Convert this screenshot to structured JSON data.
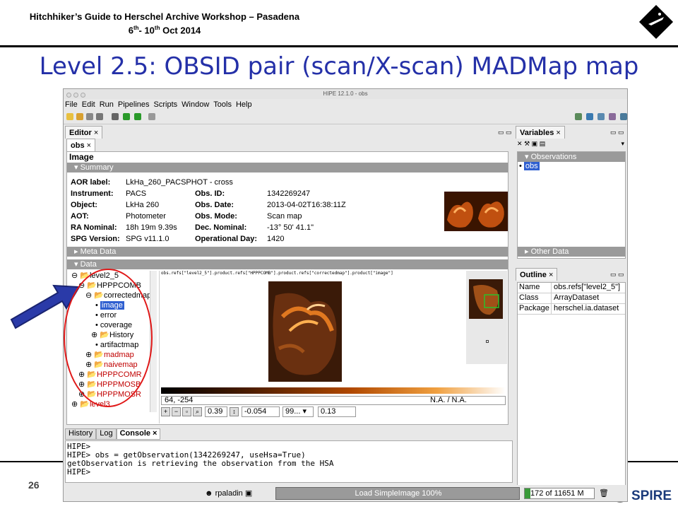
{
  "header": {
    "line1": "Hitchhiker’s Guide to Herschel Archive Workshop – Pasadena",
    "line2_a": "6",
    "line2_sup1": "th",
    "line2_b": "- 10",
    "line2_sup2": "th",
    "line2_c": " Oct 2014"
  },
  "slide_title": "Level 2.5: OBSID pair (scan/X-scan) MADMap map",
  "page_number": "26",
  "window": {
    "title": "HIPE 12.1.0 - obs",
    "menu": [
      "File",
      "Edit",
      "Run",
      "Pipelines",
      "Scripts",
      "Window",
      "Tools",
      "Help"
    ],
    "editor_tab": "Editor",
    "obs_tab": "obs",
    "image_heading": "Image",
    "summary_label": "Summary",
    "summary": {
      "left_keys": [
        "AOR label:",
        "Instrument:",
        "Object:",
        "AOT:",
        "RA Nominal:",
        "SPG Version:"
      ],
      "left_vals": [
        "LkHa_260_PACSPHOT - cross",
        "PACS",
        "LkHa 260",
        "Photometer",
        "18h 19m 9.39s",
        "SPG v11.1.0"
      ],
      "right_keys": [
        "Obs. ID:",
        "Obs. Date:",
        "Obs. Mode:",
        "Dec. Nominal:",
        "Operational Day:"
      ],
      "right_vals": [
        "1342269247",
        "2013-04-02T16:38:11Z",
        "Scan map",
        "-13° 50' 41.1\"",
        "1420"
      ]
    },
    "meta_data_label": "Meta Data",
    "data_label": "Data",
    "tree": [
      "level2_5",
      "HPPPCOMB",
      "correctedmap",
      "image",
      "error",
      "coverage",
      "History",
      "artifactmap",
      "madmap",
      "naivemap",
      "HPPPCOMR",
      "HPPPMOSB",
      "HPPPMOSR",
      "level3"
    ],
    "image_path": "obs.refs[\"level2_5\"].product.refs[\"HPPPCOMB\"].product.refs[\"correctedmap\"].product[\"image\"]",
    "cursor_readout": "64, -254",
    "value_readout": "N.A. / N.A.",
    "zoom": "0.39",
    "cut_low": "-0.054",
    "cut_mode": "99...",
    "cut_high": "0.13",
    "variables_tab": "Variables",
    "observations_label": "Observations",
    "obs_var": "obs",
    "other_data_label": "Other Data",
    "outline_tab": "Outline",
    "outline": [
      [
        "Name",
        "obs.refs[\"level2_5\"]"
      ],
      [
        "Class",
        "ArrayDataset"
      ],
      [
        "Package",
        "herschel.ia.dataset"
      ]
    ],
    "bottom_tabs": [
      "History",
      "Log",
      "Console"
    ],
    "console": [
      "HIPE>",
      "HIPE> obs = getObservation(1342269247, useHsa=True)",
      "getObservation is retrieving the observation from the HSA",
      "HIPE>"
    ],
    "status_user": "rpaladin",
    "status_progress": "Load SimpleImage 100%",
    "progress_fraction": 1.0,
    "memory": "172 of 11651 M"
  },
  "colors": {
    "title": "#2430a8",
    "selection": "#2f5fd0",
    "oval": "#e01818",
    "arrow": "#2a3aa8"
  }
}
